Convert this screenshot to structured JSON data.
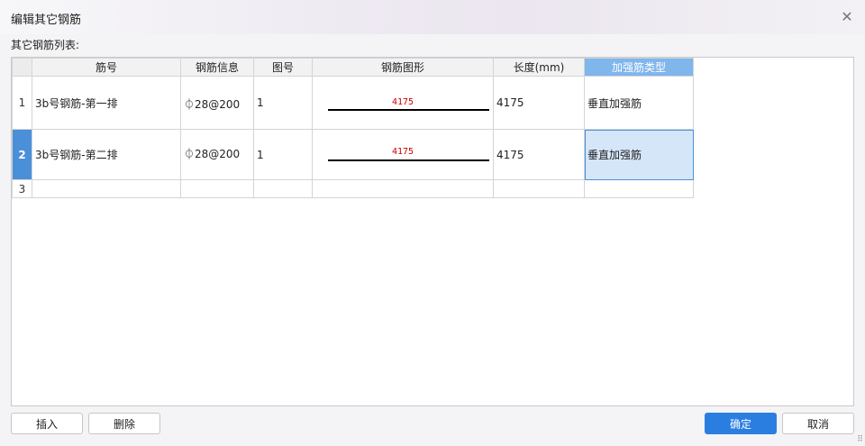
{
  "dialog": {
    "title": "编辑其它钢筋",
    "close_icon": "close-icon",
    "list_label": "其它钢筋列表:"
  },
  "grid": {
    "columns": [
      "筋号",
      "钢筋信息",
      "图号",
      "钢筋图形",
      "长度(mm)",
      "加强筋类型"
    ],
    "active_column": "加强筋类型",
    "rows": [
      {
        "num": "1",
        "name": "3b号钢筋-第一排",
        "info": "⏀28@200",
        "fig": "1",
        "shape_len": "4175",
        "length": "4175",
        "type": "垂直加强筋"
      },
      {
        "num": "2",
        "name": "3b号钢筋-第二排",
        "info": "⏀28@200",
        "fig": "1",
        "shape_len": "4175",
        "length": "4175",
        "type": "垂直加强筋"
      },
      {
        "num": "3",
        "name": "",
        "info": "",
        "fig": "",
        "shape_len": "",
        "length": "",
        "type": ""
      }
    ],
    "selected_row": "2"
  },
  "buttons": {
    "insert": "插入",
    "delete": "删除",
    "ok": "确定",
    "cancel": "取消"
  },
  "colors": {
    "accent": "#2a7ee0",
    "header_active": "#7fb6ec",
    "shape_text": "#d00000",
    "selection": "#d5e6f8"
  }
}
